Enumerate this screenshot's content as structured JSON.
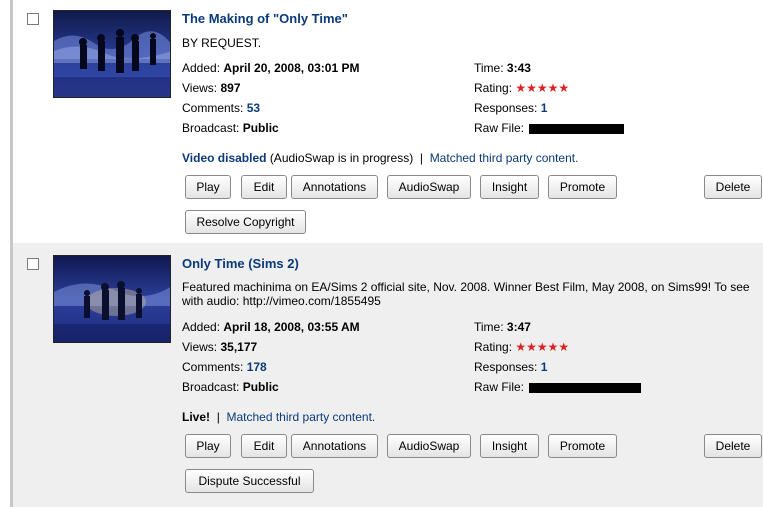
{
  "videos": [
    {
      "title": "The Making of \"Only Time\"",
      "description_line1": "BY REQUEST.",
      "description_line2": "",
      "added_label": "Added:",
      "added": "April 20, 2008, 03:01 PM",
      "views_label": "Views:",
      "views": "897",
      "comments_label": "Comments:",
      "comments": "53",
      "broadcast_label": "Broadcast:",
      "broadcast": "Public",
      "time_label": "Time:",
      "time": "3:43",
      "rating_label": "Rating:",
      "rating_stars": "★★★★★",
      "rating_value": 5,
      "responses_label": "Responses:",
      "responses": "1",
      "rawfile_label": "Raw File:",
      "status_main": "Video disabled",
      "status_detail": "(AudioSwap is in progress)",
      "separator": "|",
      "status_link": "Matched third party content.",
      "buttons": {
        "play": "Play",
        "edit": "Edit",
        "annotations": "Annotations",
        "audioswap": "AudioSwap",
        "insight": "Insight",
        "promote": "Promote",
        "delete": "Delete",
        "extra": "Resolve Copyright"
      }
    },
    {
      "title": "Only Time (Sims 2)",
      "description_line1": "Featured machinima on EA/Sims 2 official site, Nov. 2008. Winner Best Film, May 2008, on Sims99! To see",
      "description_line2": "with audio: http://vimeo.com/1855495",
      "added_label": "Added:",
      "added": "April 18, 2008, 03:55 AM",
      "views_label": "Views:",
      "views": "35,177",
      "comments_label": "Comments:",
      "comments": "178",
      "broadcast_label": "Broadcast:",
      "broadcast": "Public",
      "time_label": "Time:",
      "time": "3:47",
      "rating_label": "Rating:",
      "rating_stars": "★★★★★",
      "rating_value": 5,
      "responses_label": "Responses:",
      "responses": "1",
      "rawfile_label": "Raw File:",
      "status_main": "Live!",
      "status_detail": "",
      "separator": "|",
      "status_link": "Matched third party content.",
      "buttons": {
        "play": "Play",
        "edit": "Edit",
        "annotations": "Annotations",
        "audioswap": "AudioSwap",
        "insight": "Insight",
        "promote": "Promote",
        "delete": "Delete",
        "extra": "Dispute Successful"
      }
    }
  ],
  "colors": {
    "link": "#0a3a7a",
    "star": "#dd2222",
    "row_alt_bg": "#efefef"
  }
}
